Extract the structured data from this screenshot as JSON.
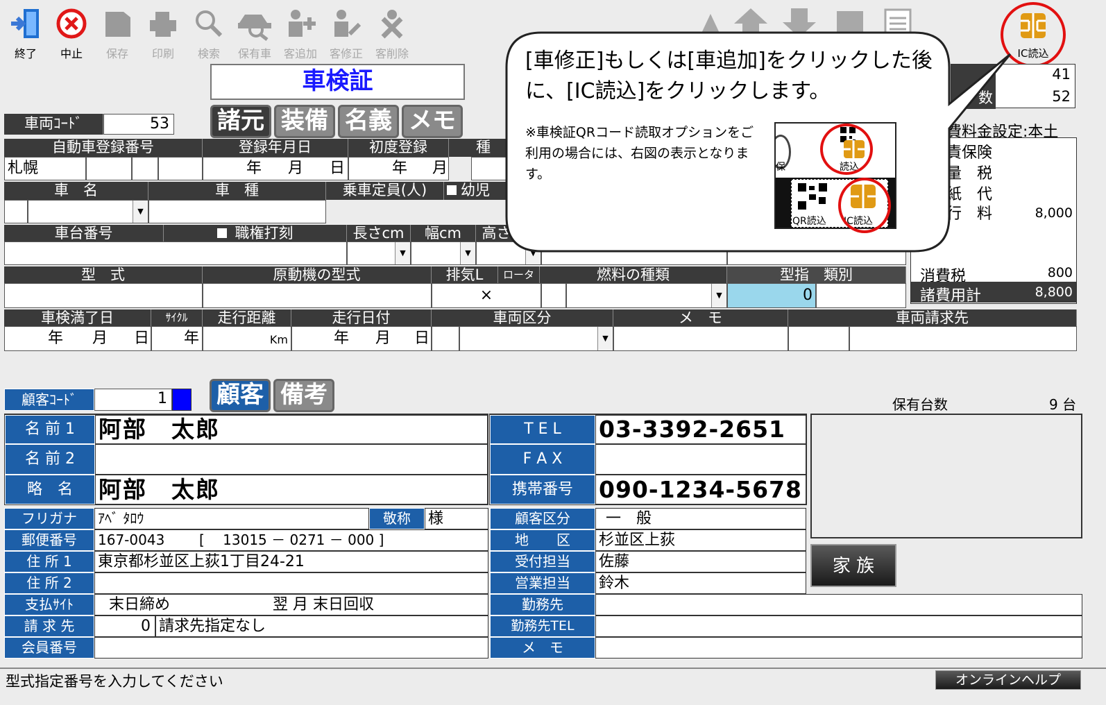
{
  "toolbar": {
    "items": [
      {
        "label": "終了",
        "icon": "exit-door-icon",
        "enabled": true
      },
      {
        "label": "中止",
        "icon": "cancel-circle-icon",
        "enabled": true
      },
      {
        "label": "保存",
        "icon": "save-icon",
        "enabled": false
      },
      {
        "label": "印刷",
        "icon": "printer-icon",
        "enabled": false
      },
      {
        "label": "検索",
        "icon": "magnifier-icon",
        "enabled": false
      },
      {
        "label": "保有車",
        "icon": "owned-car-icon",
        "enabled": false
      },
      {
        "label": "客追加",
        "icon": "add-customer-icon",
        "enabled": false
      },
      {
        "label": "客修正",
        "icon": "edit-customer-icon",
        "enabled": false
      },
      {
        "label": "客削除",
        "icon": "delete-customer-icon",
        "enabled": false
      }
    ],
    "ic_label": "IC読込"
  },
  "vehicle": {
    "title": "車検証",
    "tabs": [
      "諸元",
      "装備",
      "名義",
      "メモ"
    ],
    "code_label": "車両ｺｰﾄﾞ",
    "code_value": "53",
    "h_reg_no": "自動車登録番号",
    "h_reg_date": "登録年月日",
    "h_first_reg": "初度登録",
    "h_type_short": "種",
    "reg_office": "札幌",
    "year": "年",
    "month": "月",
    "day": "日",
    "h_car_name": "車　名",
    "h_car_kind": "車　種",
    "h_capacity": "乗車定員(人)",
    "h_child": "幼児",
    "h_chassis": "車台番号",
    "h_stamp": "職権打刻",
    "h_length": "長さcm",
    "h_width": "幅cm",
    "h_height": "高さ",
    "h_model": "型　式",
    "h_engine": "原動機の型式",
    "h_displacement": "排気L",
    "h_rotor": "ロータ",
    "h_fuel": "燃料の種類",
    "h_type_cert": "型指　類別",
    "times": "×",
    "type_cert_value": "0",
    "h_expiry": "車検満了日",
    "h_cycle": "ｻｲｸﾙ",
    "h_mileage": "走行距離",
    "h_mileage_date": "走行日付",
    "h_class": "車両区分",
    "h_memo": "メ　モ",
    "h_bill_to": "車両請求先",
    "km": "Km"
  },
  "fees": {
    "row1_value": "41",
    "row2_suffix": "数",
    "row2_value": "52",
    "setting": "費料金設定:本土",
    "items": [
      {
        "label": "責保険",
        "value": ""
      },
      {
        "label": "量　税",
        "value": ""
      },
      {
        "label": "紙　代",
        "value": ""
      },
      {
        "label": "行　料",
        "value": "8,000"
      }
    ],
    "tax_label": "消費税",
    "tax_value": "800",
    "total_label": "諸費用計",
    "total_value": "8,800"
  },
  "callout": {
    "main": "[車修正]もしくは[車追加]をクリックした後に、[IC読込]をクリックします。",
    "note": "※車検証QRコード読取オプションをご利用の場合には、右図の表示となります。",
    "inset_read": "読込",
    "inset_qr": "QR読込",
    "inset_ic": "IC読込",
    "inset_partial": "保"
  },
  "customer": {
    "tabs": [
      "顧客",
      "備考"
    ],
    "code_label": "顧客ｺｰﾄﾞ",
    "code_value": "1",
    "owned_label": "保有台数",
    "owned_value": "9 台",
    "name1_label": "名 前 1",
    "name1": "阿部　太郎",
    "name2_label": "名 前 2",
    "name2": "",
    "short_label": "略　名",
    "short_name": "阿部　太郎",
    "tel_label": "T E L",
    "tel": "03-3392-2651",
    "fax_label": "F A X",
    "fax": "",
    "mobile_label": "携帯番号",
    "mobile": "090-1234-5678",
    "kana_label": "フリガナ",
    "kana": "ｱﾍﾞ ﾀﾛｳ",
    "honorific_label": "敬称",
    "honorific": "様",
    "zip_label": "郵便番号",
    "zip": "167-0043",
    "zip_code": "[　 13015 － 0271 － 000 ]",
    "addr1_label": "住 所 1",
    "addr1": "東京都杉並区上荻1丁目24-21",
    "addr2_label": "住 所 2",
    "addr2": "",
    "pay_label": "支払ｻｲﾄ",
    "pay_close": "末日締め",
    "pay_collect": "翌 月 末日回収",
    "bill_label": "請 求 先",
    "bill_code": "0",
    "bill_name": "請求先指定なし",
    "member_label": "会員番号",
    "member": "",
    "class_label": "顧客区分",
    "class": "一　般",
    "area_label": "地　　区",
    "area": "杉並区上荻",
    "recv_label": "受付担当",
    "recv": "佐藤",
    "sales_label": "営業担当",
    "sales": "鈴木",
    "work_label": "勤務先",
    "work": "",
    "worktel_label": "勤務先TEL",
    "worktel": "",
    "memo_label": "メ　モ",
    "memo": "",
    "family": "家 族"
  },
  "status": {
    "message": "型式指定番号を入力してください",
    "help": "オンラインヘルプ"
  },
  "colors": {
    "header_dark": "#3a3a3a",
    "label_blue": "#1d5fa8",
    "highlight": "#9ad7ec",
    "callout_red": "#e21010",
    "title_blue": "#1a1aff"
  }
}
